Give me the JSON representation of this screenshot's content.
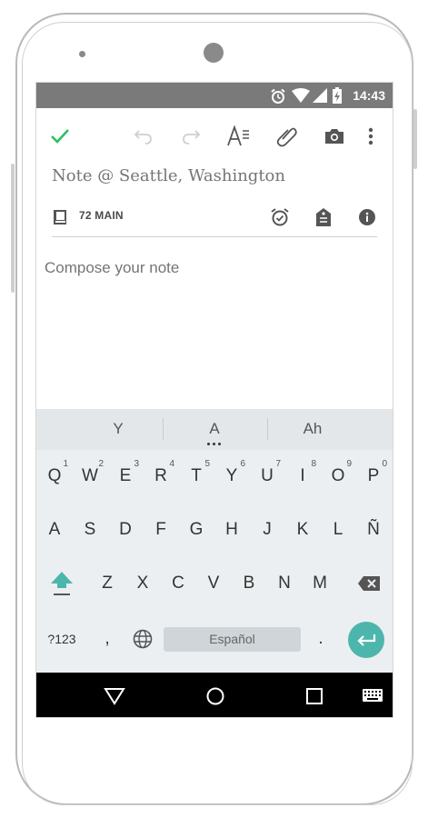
{
  "status_bar": {
    "time": "14:43"
  },
  "toolbar": {
    "icons": [
      "check-icon",
      "undo-icon",
      "redo-icon",
      "text-format-icon",
      "attachment-icon",
      "camera-icon",
      "more-vert-icon"
    ]
  },
  "note": {
    "title_placeholder": "Note @ Seattle, Washington",
    "notebook": "72 MAIN",
    "body_placeholder": "Compose your note"
  },
  "keyboard": {
    "suggestions": [
      "Y",
      "A",
      "Ah"
    ],
    "row1": [
      {
        "key": "Q",
        "hint": "1"
      },
      {
        "key": "W",
        "hint": "2"
      },
      {
        "key": "E",
        "hint": "3"
      },
      {
        "key": "R",
        "hint": "4"
      },
      {
        "key": "T",
        "hint": "5"
      },
      {
        "key": "Y",
        "hint": "6"
      },
      {
        "key": "U",
        "hint": "7"
      },
      {
        "key": "I",
        "hint": "8"
      },
      {
        "key": "O",
        "hint": "9"
      },
      {
        "key": "P",
        "hint": "0"
      }
    ],
    "row2": [
      "A",
      "S",
      "D",
      "F",
      "G",
      "H",
      "J",
      "K",
      "L",
      "Ñ"
    ],
    "row3": [
      "Z",
      "X",
      "C",
      "V",
      "B",
      "N",
      "M"
    ],
    "symbols_label": "?123",
    "comma": ",",
    "period": ".",
    "space_label": "Español"
  },
  "colors": {
    "accent_green": "#2dbe60",
    "enter_key": "#4db6ac",
    "shift_key": "#4db6ac"
  }
}
